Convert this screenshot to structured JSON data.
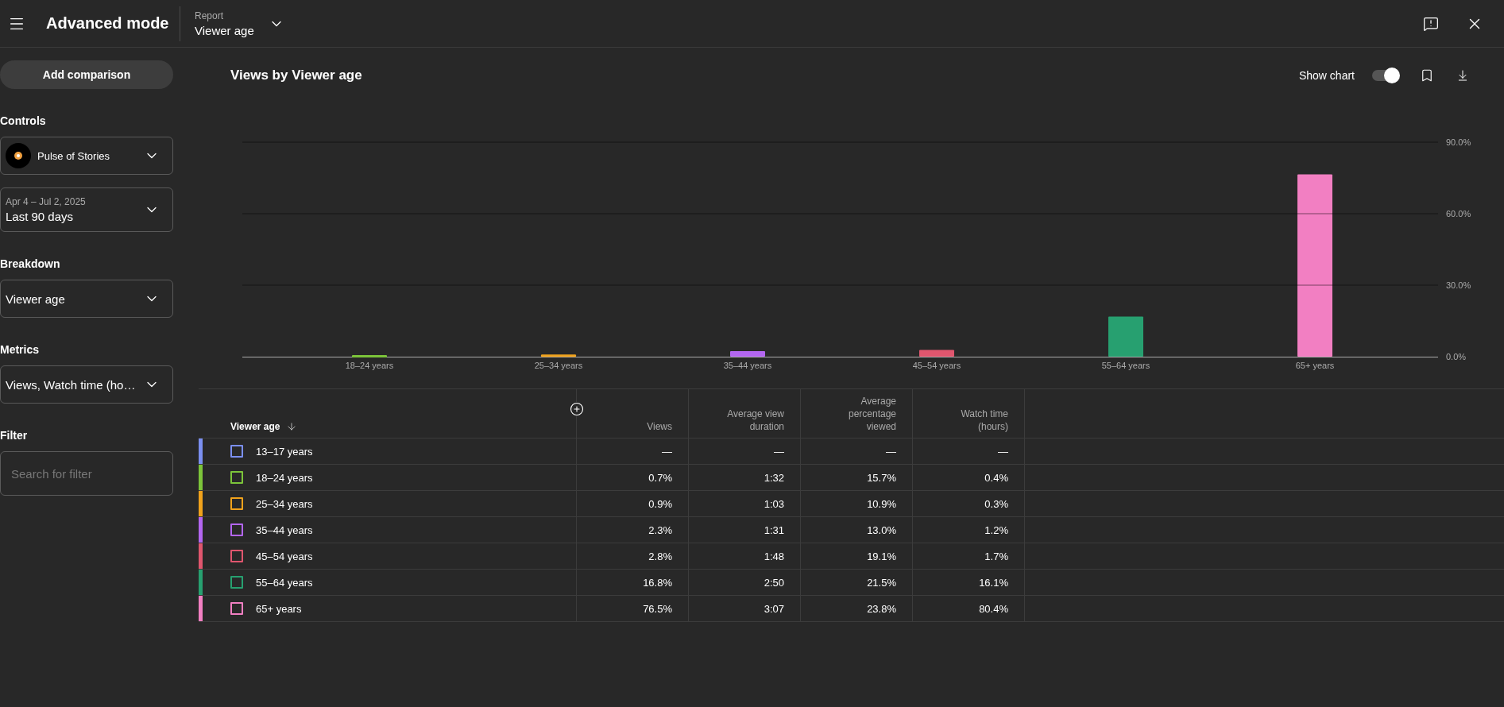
{
  "header": {
    "title": "Advanced mode",
    "report_label": "Report",
    "report_value": "Viewer age"
  },
  "sidebar": {
    "button": "Add comparison",
    "controls": {
      "label": "Controls",
      "channel": "Pulse of Stories",
      "date_range": "Apr 4 – Jul 2, 2025",
      "period": "Last 90 days"
    },
    "breakdown": {
      "label": "Breakdown",
      "value": "Viewer age"
    },
    "metrics": {
      "label": "Metrics",
      "value": "Views, Watch time (ho…"
    },
    "filter": {
      "label": "Filter",
      "placeholder": "Search for filter"
    }
  },
  "chart_panel": {
    "title": "Views by Viewer age",
    "show_chart_label": "Show chart",
    "show_chart": true,
    "chart_data": {
      "type": "bar",
      "categories": [
        "18–24 years",
        "25–34 years",
        "35–44 years",
        "45–54 years",
        "55–64 years",
        "65+ years"
      ],
      "series": [
        {
          "values": [
            0.7,
            0.9,
            2.3,
            2.8,
            16.8,
            76.5
          ]
        }
      ],
      "ylim": [
        0,
        90
      ],
      "yticks": [
        {
          "value": 0,
          "label": "0.0%"
        },
        {
          "value": 30,
          "label": "30.0%"
        },
        {
          "value": 60,
          "label": "60.0%"
        },
        {
          "value": 90,
          "label": "90.0%"
        }
      ]
    }
  },
  "table": {
    "columns": [
      "Viewer age",
      "Views",
      "Average view duration",
      "Average percentage viewed",
      "Watch time (hours)"
    ],
    "rows": [
      {
        "color": "#7b8ff0",
        "checked": false,
        "cells": [
          "13–17 years",
          "—",
          "—",
          "—",
          "—"
        ]
      },
      {
        "color": "#7cc43a",
        "checked": false,
        "cells": [
          "18–24 years",
          "0.7%",
          "1:32",
          "15.7%",
          "0.4%"
        ]
      },
      {
        "color": "#f0a21c",
        "checked": false,
        "cells": [
          "25–34 years",
          "0.9%",
          "1:03",
          "10.9%",
          "0.3%"
        ]
      },
      {
        "color": "#b366f0",
        "checked": false,
        "cells": [
          "35–44 years",
          "2.3%",
          "1:31",
          "13.0%",
          "1.2%"
        ]
      },
      {
        "color": "#e0566e",
        "checked": false,
        "cells": [
          "45–54 years",
          "2.8%",
          "1:48",
          "19.1%",
          "1.7%"
        ]
      },
      {
        "color": "#27a070",
        "checked": false,
        "cells": [
          "55–64 years",
          "16.8%",
          "2:50",
          "21.5%",
          "16.1%"
        ]
      },
      {
        "color": "#f27fc2",
        "checked": false,
        "cells": [
          "65+ years",
          "76.5%",
          "3:07",
          "23.8%",
          "80.4%"
        ]
      }
    ]
  }
}
